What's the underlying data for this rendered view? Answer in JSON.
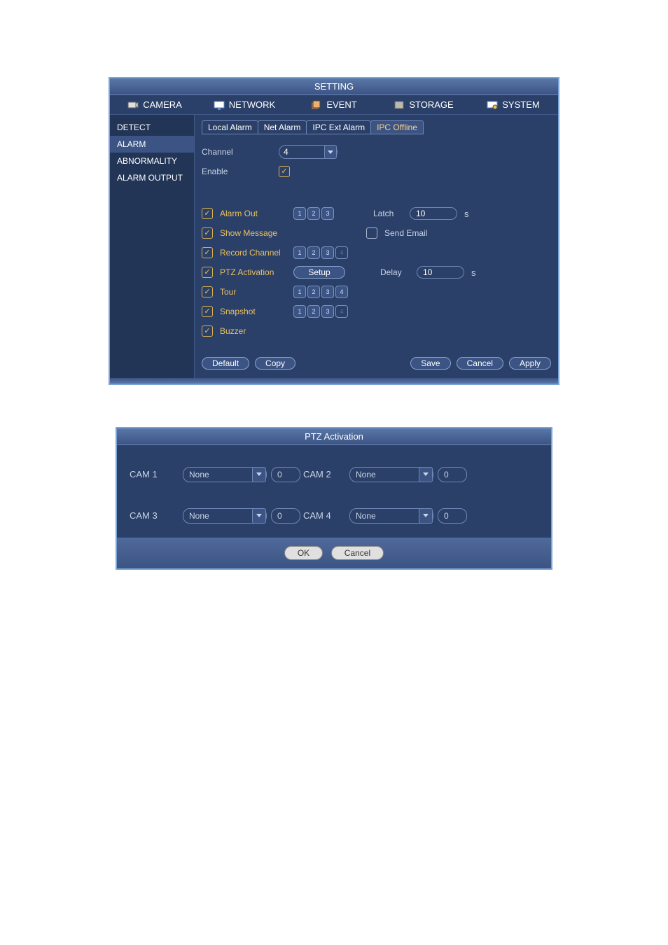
{
  "setting_window": {
    "title": "SETTING",
    "top_tabs": [
      {
        "label": "CAMERA"
      },
      {
        "label": "NETWORK"
      },
      {
        "label": "EVENT"
      },
      {
        "label": "STORAGE"
      },
      {
        "label": "SYSTEM"
      }
    ],
    "sidebar": [
      {
        "label": "DETECT"
      },
      {
        "label": "ALARM"
      },
      {
        "label": "ABNORMALITY"
      },
      {
        "label": "ALARM OUTPUT"
      }
    ],
    "subtabs": [
      {
        "label": "Local Alarm"
      },
      {
        "label": "Net Alarm"
      },
      {
        "label": "IPC Ext Alarm"
      },
      {
        "label": "IPC Offline"
      }
    ],
    "channel_label": "Channel",
    "channel_value": "4",
    "enable_label": "Enable",
    "alarm_out_label": "Alarm Out",
    "latch_label": "Latch",
    "latch_value": "10",
    "seconds_unit": "s",
    "show_message_label": "Show Message",
    "send_email_label": "Send Email",
    "record_channel_label": "Record Channel",
    "ptz_activation_label": "PTZ Activation",
    "setup_btn": "Setup",
    "delay_label": "Delay",
    "delay_value": "10",
    "tour_label": "Tour",
    "snapshot_label": "Snapshot",
    "buzzer_label": "Buzzer",
    "footer": {
      "default": "Default",
      "copy": "Copy",
      "save": "Save",
      "cancel": "Cancel",
      "apply": "Apply"
    }
  },
  "ptz_window": {
    "title": "PTZ Activation",
    "rows": [
      {
        "left_label": "CAM 1",
        "left_mode": "None",
        "left_val": "0",
        "right_label": "CAM 2",
        "right_mode": "None",
        "right_val": "0"
      },
      {
        "left_label": "CAM 3",
        "left_mode": "None",
        "left_val": "0",
        "right_label": "CAM 4",
        "right_mode": "None",
        "right_val": "0"
      }
    ],
    "ok": "OK",
    "cancel": "Cancel"
  }
}
